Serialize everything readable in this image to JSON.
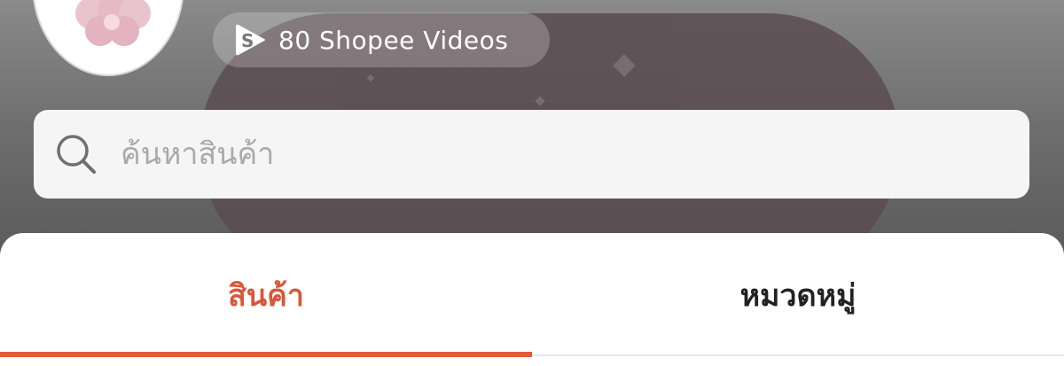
{
  "shop": {
    "videos_label": "80 Shopee Videos"
  },
  "search": {
    "placeholder": "ค้นหาสินค้า"
  },
  "tabs": [
    {
      "label": "สินค้า",
      "active": true
    },
    {
      "label": "หมวดหมู่",
      "active": false
    }
  ],
  "colors": {
    "accent": "#e05a3a",
    "active_tab_text": "#d9563a",
    "search_bg": "#f5f5f5"
  },
  "icons": [
    "shopee-video-icon",
    "search-icon",
    "flower-logo"
  ]
}
